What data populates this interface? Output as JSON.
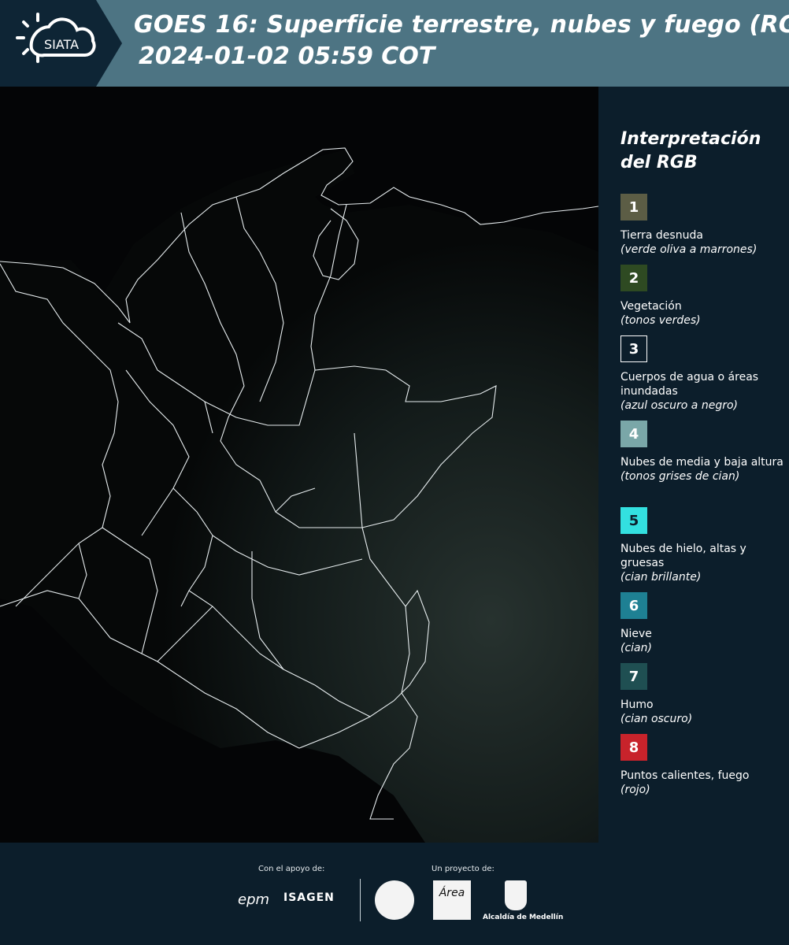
{
  "header": {
    "logo_text": "SIATA",
    "title_line1": "GOES 16: Superficie terrestre, nubes y fuego (RGB)",
    "title_line2": "2024-01-02 05:59 COT"
  },
  "legend": {
    "title": "Interpretación del RGB",
    "items": [
      {
        "number": "1",
        "name": "Tierra desnuda",
        "desc": "(verde oliva a marrones)",
        "color": "#5c5d45",
        "text_color": "#ffffff"
      },
      {
        "number": "2",
        "name": "Vegetación",
        "desc": "(tonos verdes)",
        "color": "#2e4a22",
        "text_color": "#ffffff"
      },
      {
        "number": "3",
        "name": "Cuerpos de agua o áreas inundadas",
        "desc": "(azul oscuro a negro)",
        "color": "#0c1e2b",
        "text_color": "#ffffff"
      },
      {
        "number": "4",
        "name": "Nubes de media y baja altura",
        "desc": "(tonos grises de cian)",
        "color": "#7aa7a8",
        "text_color": "#ffffff"
      },
      {
        "number": "5",
        "name": "Nubes de hielo, altas y gruesas",
        "desc": "(cian brillante)",
        "color": "#33e0e0",
        "text_color": "#0c1e2b"
      },
      {
        "number": "6",
        "name": "Nieve",
        "desc": "(cian)",
        "color": "#1e8093",
        "text_color": "#ffffff"
      },
      {
        "number": "7",
        "name": "Humo",
        "desc": "(cian oscuro)",
        "color": "#1f4f52",
        "text_color": "#ffffff"
      },
      {
        "number": "8",
        "name": "Puntos calientes, fuego",
        "desc": "(rojo)",
        "color": "#c8232b",
        "text_color": "#ffffff"
      }
    ]
  },
  "footer": {
    "support_label": "Con el apoyo de:",
    "project_label": "Un proyecto de:",
    "sponsor_epm": "epm",
    "sponsor_isagen": "ISAGEN",
    "area_logo_text": "Área",
    "alcaldia_name": "Alcaldía de Medellín"
  }
}
